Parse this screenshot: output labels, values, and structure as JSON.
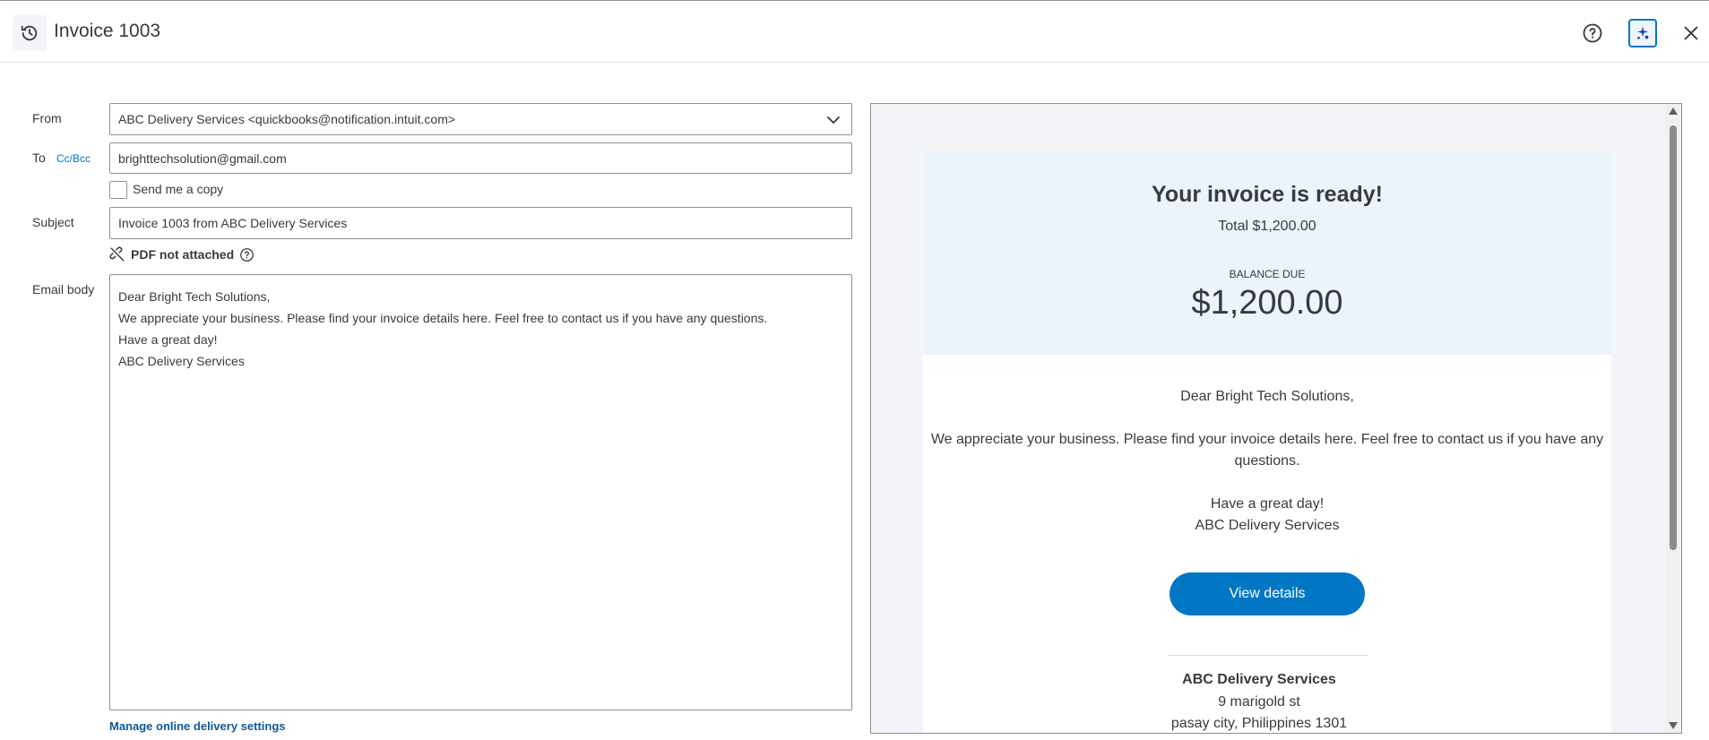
{
  "header": {
    "title": "Invoice 1003",
    "icons": {
      "history": "history-icon",
      "help": "help-icon",
      "assistant": "ai-assistant-icon",
      "close": "close-icon"
    },
    "accent": "#0077c5"
  },
  "form": {
    "from_label": "From",
    "from_value": "ABC Delivery Services <quickbooks@notification.intuit.com>",
    "to_label": "To",
    "cc_bcc_label": "Cc/Bcc",
    "to_value": "brighttechsolution@gmail.com",
    "send_copy_label": "Send me a copy",
    "send_copy_checked": false,
    "subject_label": "Subject",
    "subject_value": "Invoice 1003 from ABC Delivery Services",
    "pdf_status": "PDF not attached",
    "email_body_label": "Email body",
    "email_body_lines": [
      "Dear Bright Tech Solutions,",
      "",
      "We appreciate your business. Please find your invoice details here. Feel free to contact us if you have any questions.",
      "",
      "Have a great day!",
      "ABC Delivery Services"
    ],
    "manage_link": "Manage online delivery settings"
  },
  "preview": {
    "heading": "Your invoice is ready!",
    "total": "Total $1,200.00",
    "balance_label": "BALANCE DUE",
    "balance_amount": "$1,200.00",
    "greeting": "Dear Bright Tech Solutions,",
    "message_line1": "We appreciate your business. Please find your invoice details here. Feel free to contact us if you have any",
    "message_line2": "questions.",
    "closing": "Have a great day!",
    "signature": "ABC Delivery Services",
    "view_button": "View details",
    "company_name": "ABC Delivery Services",
    "address_line1": "9 marigold st",
    "address_line2": "pasay city, Philippines 1301",
    "colors": {
      "top_panel": "#ebf3fb",
      "button": "#0077c5"
    }
  }
}
